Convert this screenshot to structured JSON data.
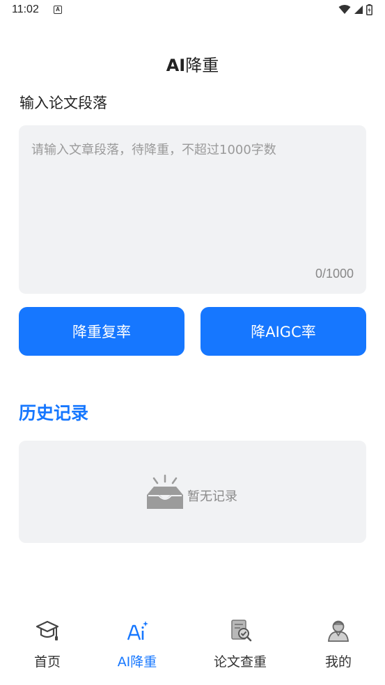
{
  "status_bar": {
    "time": "11:02",
    "notification_icon_letter": "A",
    "icons": [
      "wifi-icon",
      "signal-icon",
      "battery-icon"
    ]
  },
  "header": {
    "title_bold": "AI",
    "title_rest": "降重"
  },
  "input_section": {
    "label": "输入论文段落",
    "placeholder": "请输入文章段落，待降重，不超过1000字数",
    "counter": "0/1000"
  },
  "actions": {
    "reduce_duplication_label": "降重复率",
    "reduce_aigc_label": "降AIGC率"
  },
  "history": {
    "title": "历史记录",
    "empty_text": "暂无记录"
  },
  "tabbar": {
    "items": [
      {
        "label": "首页",
        "icon": "graduation-cap-icon",
        "active": false
      },
      {
        "label": "AI降重",
        "icon": "ai-sparkle-icon",
        "active": true
      },
      {
        "label": "论文查重",
        "icon": "document-check-icon",
        "active": false
      },
      {
        "label": "我的",
        "icon": "user-profile-icon",
        "active": false
      }
    ]
  },
  "colors": {
    "accent": "#1677ff",
    "panel_bg": "#f1f2f4",
    "placeholder_text": "#9a9a9a"
  }
}
